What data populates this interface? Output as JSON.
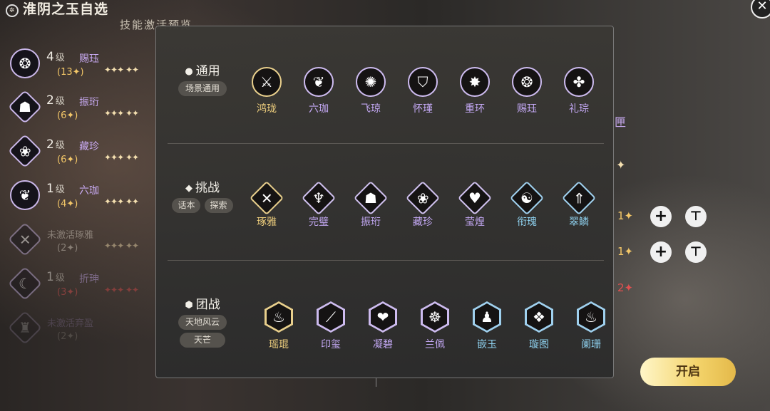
{
  "header": {
    "title": "淮阴之玉自选",
    "subtitle": "技能激活预览"
  },
  "roster": [
    {
      "level": "4",
      "level_unit": "级",
      "name": "赐珏",
      "count": "(13✦)",
      "stars": "✦✦✦ ✦✦",
      "icon": "jade-lotus-icon"
    },
    {
      "level": "2",
      "level_unit": "级",
      "name": "振珩",
      "count": "(6✦)",
      "stars": "✦✦✦ ✦✦",
      "icon": "beast-face-icon"
    },
    {
      "level": "2",
      "level_unit": "级",
      "name": "藏珍",
      "count": "(6✦)",
      "stars": "✦✦✦ ✦✦",
      "icon": "phoenix-icon"
    },
    {
      "level": "1",
      "level_unit": "级",
      "name": "六珈",
      "count": "(4✦)",
      "stars": "✦✦✦ ✦✦",
      "icon": "sprout-icon"
    },
    {
      "level": "",
      "level_unit": "",
      "name": "未激活琢雅",
      "count": "(2✦)",
      "stars": "✦✦✦ ✦✦",
      "icon": "crossed-blades-icon"
    },
    {
      "level": "1",
      "level_unit": "级",
      "name": "折珅",
      "count": "(3✦)",
      "stars": "✦✦✦ ✦✦",
      "icon": "crescent-blade-icon"
    },
    {
      "level": "",
      "level_unit": "",
      "name": "未激活弃盈",
      "count": "(2✦)",
      "stars": "",
      "icon": "tower-icon"
    }
  ],
  "right_side": {
    "partial_label": "匣",
    "star_single": "✦",
    "row1_count": "1✦",
    "row2_count": "1✦",
    "row3_count": "2✦",
    "plus_label": "+",
    "pin_label": "⊤",
    "start_button": "开启"
  },
  "panel": {
    "categories": [
      {
        "shape": "●",
        "name": "通用",
        "tags": [
          "场景通用"
        ]
      },
      {
        "shape": "◆",
        "name": "挑战",
        "tags": [
          "话本",
          "探索"
        ]
      },
      {
        "shape": "⬢",
        "name": "团战",
        "tags": [
          "天地风云",
          "天芒"
        ]
      }
    ],
    "general_skills": [
      {
        "name": "鸿珑",
        "color": "gold",
        "icon": "sword-slash-icon",
        "glyph": "⚔"
      },
      {
        "name": "六珈",
        "color": "purple",
        "icon": "sprout-icon",
        "glyph": "❦"
      },
      {
        "name": "飞琼",
        "color": "purple",
        "icon": "swirl-blade-icon",
        "glyph": "✺"
      },
      {
        "name": "怀瑾",
        "color": "purple",
        "icon": "shield-burst-icon",
        "glyph": "⛉"
      },
      {
        "name": "重环",
        "color": "purple",
        "icon": "impact-icon",
        "glyph": "✸"
      },
      {
        "name": "赐珏",
        "color": "purple",
        "icon": "jade-lotus-icon",
        "glyph": "❂"
      },
      {
        "name": "礼琮",
        "color": "purple",
        "icon": "fan-blades-icon",
        "glyph": "✤"
      }
    ],
    "challenge_skills": [
      {
        "name": "琢雅",
        "color": "gold",
        "icon": "crossed-blades-icon",
        "glyph": "✕"
      },
      {
        "name": "完璧",
        "color": "purple",
        "icon": "embrace-icon",
        "glyph": "♆"
      },
      {
        "name": "振珩",
        "color": "purple",
        "icon": "beast-face-icon",
        "glyph": "☗"
      },
      {
        "name": "藏珍",
        "color": "purple",
        "icon": "phoenix-icon",
        "glyph": "❀"
      },
      {
        "name": "莹煌",
        "color": "purple",
        "icon": "shield-heart-icon",
        "glyph": "♥"
      },
      {
        "name": "衔瑰",
        "color": "blue",
        "icon": "dragon-icon",
        "glyph": "☯"
      },
      {
        "name": "翠鳞",
        "color": "blue",
        "icon": "flame-arrow-icon",
        "glyph": "⇑"
      }
    ],
    "team_skills": [
      {
        "name": "瑶琨",
        "color": "gold",
        "icon": "flame-sword-icon",
        "glyph": "♨"
      },
      {
        "name": "印玺",
        "color": "purple",
        "icon": "dagger-icon",
        "glyph": "⟋"
      },
      {
        "name": "凝碧",
        "color": "purple",
        "icon": "heart-shield-icon",
        "glyph": "❤"
      },
      {
        "name": "兰佩",
        "color": "purple",
        "icon": "meditation-icon",
        "glyph": "☸"
      },
      {
        "name": "嵌玉",
        "color": "blue",
        "icon": "figure-icon",
        "glyph": "♟"
      },
      {
        "name": "璇图",
        "color": "blue",
        "icon": "scroll-icon",
        "glyph": "❖"
      },
      {
        "name": "阑珊",
        "color": "blue",
        "icon": "fire-icon",
        "glyph": "♨"
      }
    ]
  },
  "colors": {
    "gold": "#efcf7d",
    "purple": "#c2a7f2",
    "blue": "#8fd2f0",
    "start_button": "#f3d36a"
  }
}
